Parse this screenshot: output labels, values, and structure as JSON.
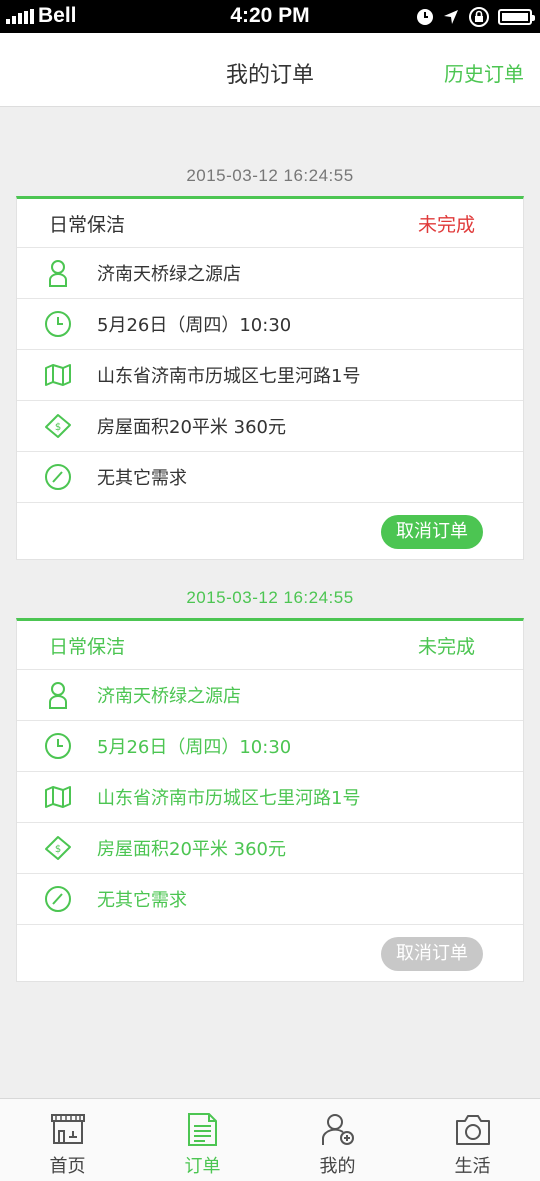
{
  "status_bar": {
    "carrier": "Bell",
    "time": "4:20 PM",
    "battery_level": 1.0
  },
  "nav": {
    "title": "我的订单",
    "history_link": "历史订单"
  },
  "orders": [
    {
      "date": "2015-03-12  16:24:55",
      "type": "日常保洁",
      "status": "未完成",
      "store": "济南天桥绿之源店",
      "time": "5月26日（周四）10:30",
      "address": "山东省济南市历城区七里河路1号",
      "area_price": "房屋面积20平米   360元",
      "note": "无其它需求",
      "cancel_label": "取消订单",
      "cancel_enabled": true
    },
    {
      "date": "2015-03-12  16:24:55",
      "type": "日常保洁",
      "status": "未完成",
      "store": "济南天桥绿之源店",
      "time": "5月26日（周四）10:30",
      "address": "山东省济南市历城区七里河路1号",
      "area_price": "房屋面积20平米   360元",
      "note": "无其它需求",
      "cancel_label": "取消订单",
      "cancel_enabled": false
    }
  ],
  "tabs": [
    {
      "label": "首页",
      "icon": "shop-icon",
      "active": false
    },
    {
      "label": "订单",
      "icon": "document-icon",
      "active": true
    },
    {
      "label": "我的",
      "icon": "user-add-icon",
      "active": false
    },
    {
      "label": "生活",
      "icon": "camera-icon",
      "active": false
    }
  ],
  "colors": {
    "accent": "#4cc552",
    "status_red": "#e03a3a",
    "disabled": "#c8c8c8"
  }
}
